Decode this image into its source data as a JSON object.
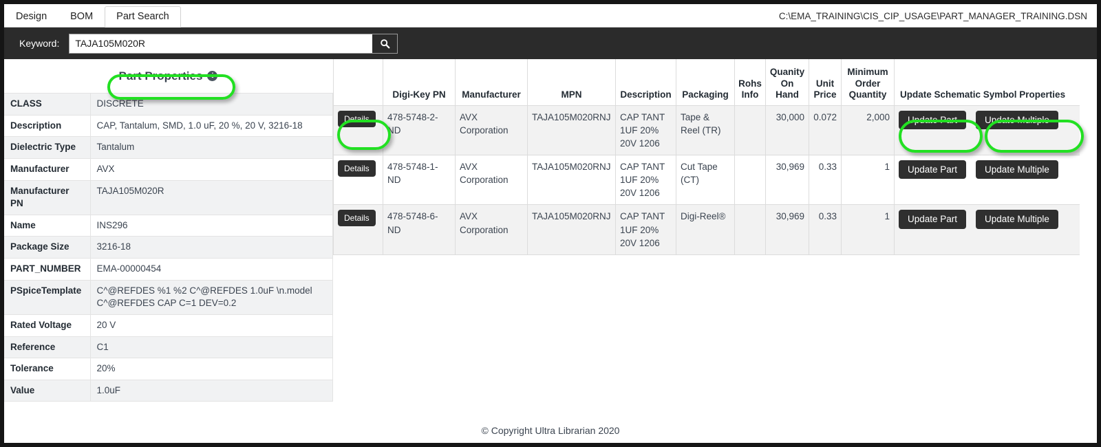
{
  "window": {
    "dsn_path": "C:\\EMA_TRAINING\\CIS_CIP_USAGE\\PART_MANAGER_TRAINING.DSN"
  },
  "tabs": [
    {
      "label": "Design",
      "active": false
    },
    {
      "label": "BOM",
      "active": false
    },
    {
      "label": "Part Search",
      "active": true
    }
  ],
  "search": {
    "label": "Keyword:",
    "value": "TAJA105M020R",
    "placeholder": "",
    "button_icon": "search-icon"
  },
  "part_properties": {
    "title": "Part Properties",
    "info_icon": "info-icon",
    "rows": [
      {
        "key": "CLASS",
        "value": "DISCRETE"
      },
      {
        "key": "Description",
        "value": "CAP, Tantalum, SMD, 1.0 uF, 20 %, 20 V, 3216-18"
      },
      {
        "key": "Dielectric Type",
        "value": "Tantalum"
      },
      {
        "key": "Manufacturer",
        "value": "AVX"
      },
      {
        "key": "Manufacturer PN",
        "value": "TAJA105M020R"
      },
      {
        "key": "Name",
        "value": "INS296"
      },
      {
        "key": "Package Size",
        "value": "3216-18"
      },
      {
        "key": "PART_NUMBER",
        "value": "EMA-00000454"
      },
      {
        "key": "PSpiceTemplate",
        "value": "C^@REFDES %1 %2 C^@REFDES 1.0uF \\n.model C^@REFDES CAP C=1 DEV=0.2"
      },
      {
        "key": "Rated Voltage",
        "value": "20 V"
      },
      {
        "key": "Reference",
        "value": "C1"
      },
      {
        "key": "Tolerance",
        "value": "20%"
      },
      {
        "key": "Value",
        "value": "1.0uF"
      }
    ]
  },
  "results": {
    "headers": [
      "",
      "Digi-Key PN",
      "Manufacturer",
      "MPN",
      "Description",
      "Packaging",
      "Rohs Info",
      "Quanity On Hand",
      "Unit Price",
      "Minimum Order Quantity",
      "Update Schematic Symbol Properties"
    ],
    "details_label": "Details",
    "update_part_label": "Update Part",
    "update_multiple_label": "Update Multiple",
    "rows": [
      {
        "digikey_pn": "478-5748-2-ND",
        "manufacturer": "AVX Corporation",
        "mpn": "TAJA105M020RNJ",
        "description": "CAP TANT 1UF 20% 20V 1206",
        "packaging": "Tape & Reel (TR)",
        "rohs_info": "",
        "quantity_on_hand": "30,000",
        "unit_price": "0.072",
        "minimum_order_quantity": "2,000"
      },
      {
        "digikey_pn": "478-5748-1-ND",
        "manufacturer": "AVX Corporation",
        "mpn": "TAJA105M020RNJ",
        "description": "CAP TANT 1UF 20% 20V 1206",
        "packaging": "Cut Tape (CT)",
        "rohs_info": "",
        "quantity_on_hand": "30,969",
        "unit_price": "0.33",
        "minimum_order_quantity": "1"
      },
      {
        "digikey_pn": "478-5748-6-ND",
        "manufacturer": "AVX Corporation",
        "mpn": "TAJA105M020RNJ",
        "description": "CAP TANT 1UF 20% 20V 1206",
        "packaging": "Digi-Reel®",
        "rohs_info": "",
        "quantity_on_hand": "30,969",
        "unit_price": "0.33",
        "minimum_order_quantity": "1"
      }
    ]
  },
  "scrollbar": {
    "left_arrow": "◀",
    "right_arrow": "▶"
  },
  "footer": {
    "text": "© Copyright Ultra Librarian 2020"
  },
  "colors": {
    "highlight_green": "#22e022",
    "dark_bar": "#2b2b2b",
    "button_dark": "#2f2f2f"
  }
}
